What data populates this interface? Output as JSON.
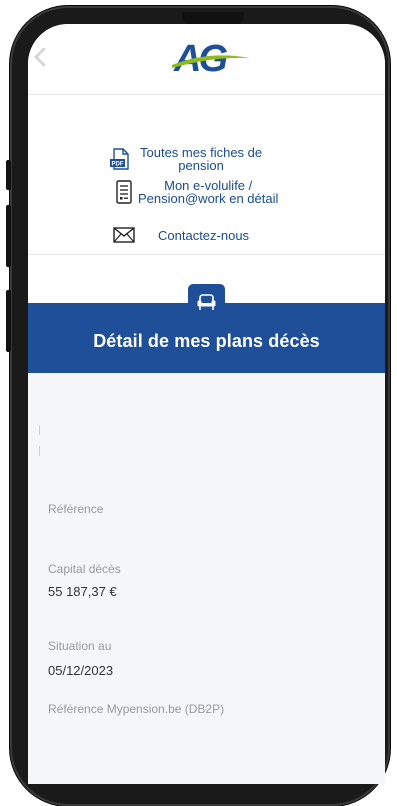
{
  "header": {
    "back_icon": "chevron-left-icon",
    "logo_text": "AG",
    "brand_blue": "#1f4f98",
    "brand_green": "#8ebd1a"
  },
  "links": [
    {
      "icon": "pdf-document-icon",
      "label": "Toutes mes fiches de\npension"
    },
    {
      "icon": "document-list-icon",
      "label": "Mon e-volulife /\nPension@work en détail"
    },
    {
      "icon": "envelope-icon",
      "label": "Contactez-nous"
    }
  ],
  "section": {
    "icon": "armchair-icon",
    "title": "Détail de mes plans décès"
  },
  "details": {
    "reference_label": "Référence",
    "capital_label": "Capital décès",
    "capital_value": "55 187,37 €",
    "situation_label": "Situation au",
    "situation_value": "05/12/2023",
    "mypension_label": "Référence Mypension.be (DB2P)"
  }
}
